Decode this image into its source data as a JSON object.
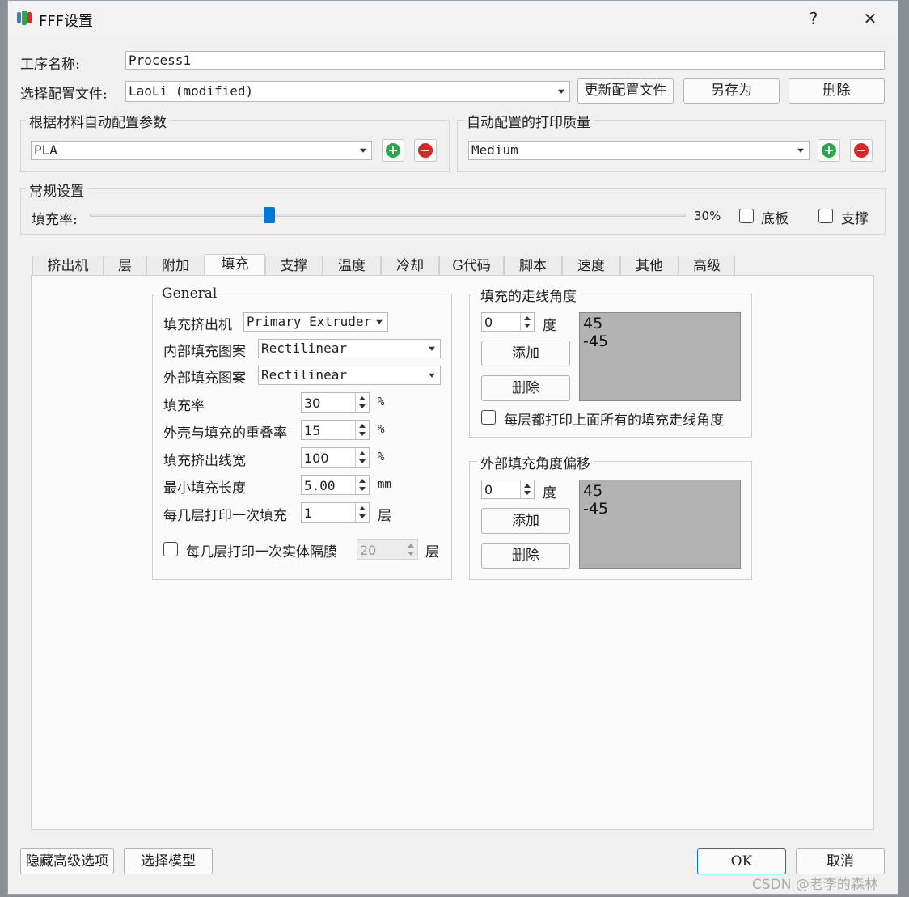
{
  "window": {
    "title": "FFF设置",
    "help": "?",
    "close": "✕"
  },
  "process_name": {
    "label": "工序名称:",
    "value": "Process1"
  },
  "profile": {
    "label": "选择配置文件:",
    "value": "LaoLi (modified)",
    "update": "更新配置文件",
    "save_as": "另存为",
    "delete": "删除"
  },
  "material_group": {
    "title": "根据材料自动配置参数",
    "value": "PLA"
  },
  "quality_group": {
    "title": "自动配置的打印质量",
    "value": "Medium"
  },
  "general": {
    "title": "常规设置",
    "infill_label": "填充率:",
    "infill_value_text": "30%",
    "infill_fraction": 0.3,
    "raft_label": "底板",
    "support_label": "支撑"
  },
  "tabs": [
    "挤出机",
    "层",
    "附加",
    "填充",
    "支撑",
    "温度",
    "冷却",
    "G代码",
    "脚本",
    "速度",
    "其他",
    "高级"
  ],
  "active_tab": "填充",
  "fill_general": {
    "title": "General",
    "extruder_label": "填充挤出机",
    "extruder_value": "Primary Extruder",
    "interior_label": "内部填充图案",
    "interior_value": "Rectilinear",
    "exterior_label": "外部填充图案",
    "exterior_value": "Rectilinear",
    "rows": [
      {
        "label": "填充率",
        "value": "30",
        "unit": "%"
      },
      {
        "label": "外壳与填充的重叠率",
        "value": "15",
        "unit": "%"
      },
      {
        "label": "填充挤出线宽",
        "value": "100",
        "unit": "%"
      },
      {
        "label": "最小填充长度",
        "value": "5.00",
        "unit": "mm"
      },
      {
        "label": "每几层打印一次填充",
        "value": "1",
        "unit": "层"
      }
    ],
    "solid_label": "每几层打印一次实体隔膜",
    "solid_value": "20",
    "solid_unit": "层"
  },
  "fill_angles": {
    "title": "填充的走线角度",
    "spin_value": "0",
    "unit": "度",
    "add": "添加",
    "delete": "删除",
    "items": [
      "45",
      "-45"
    ],
    "all_layers_label": "每层都打印上面所有的填充走线角度"
  },
  "exterior_offset": {
    "title": "外部填充角度偏移",
    "spin_value": "0",
    "unit": "度",
    "add": "添加",
    "delete": "删除",
    "items": [
      "45",
      "-45"
    ]
  },
  "footer": {
    "hide_advanced": "隐藏高级选项",
    "select_model": "选择模型",
    "ok": "OK",
    "cancel": "取消"
  },
  "watermark": "CSDN @老李的森林",
  "colors": {
    "accent": "#0078d4",
    "listbox_bg": "#b3b3b3"
  }
}
